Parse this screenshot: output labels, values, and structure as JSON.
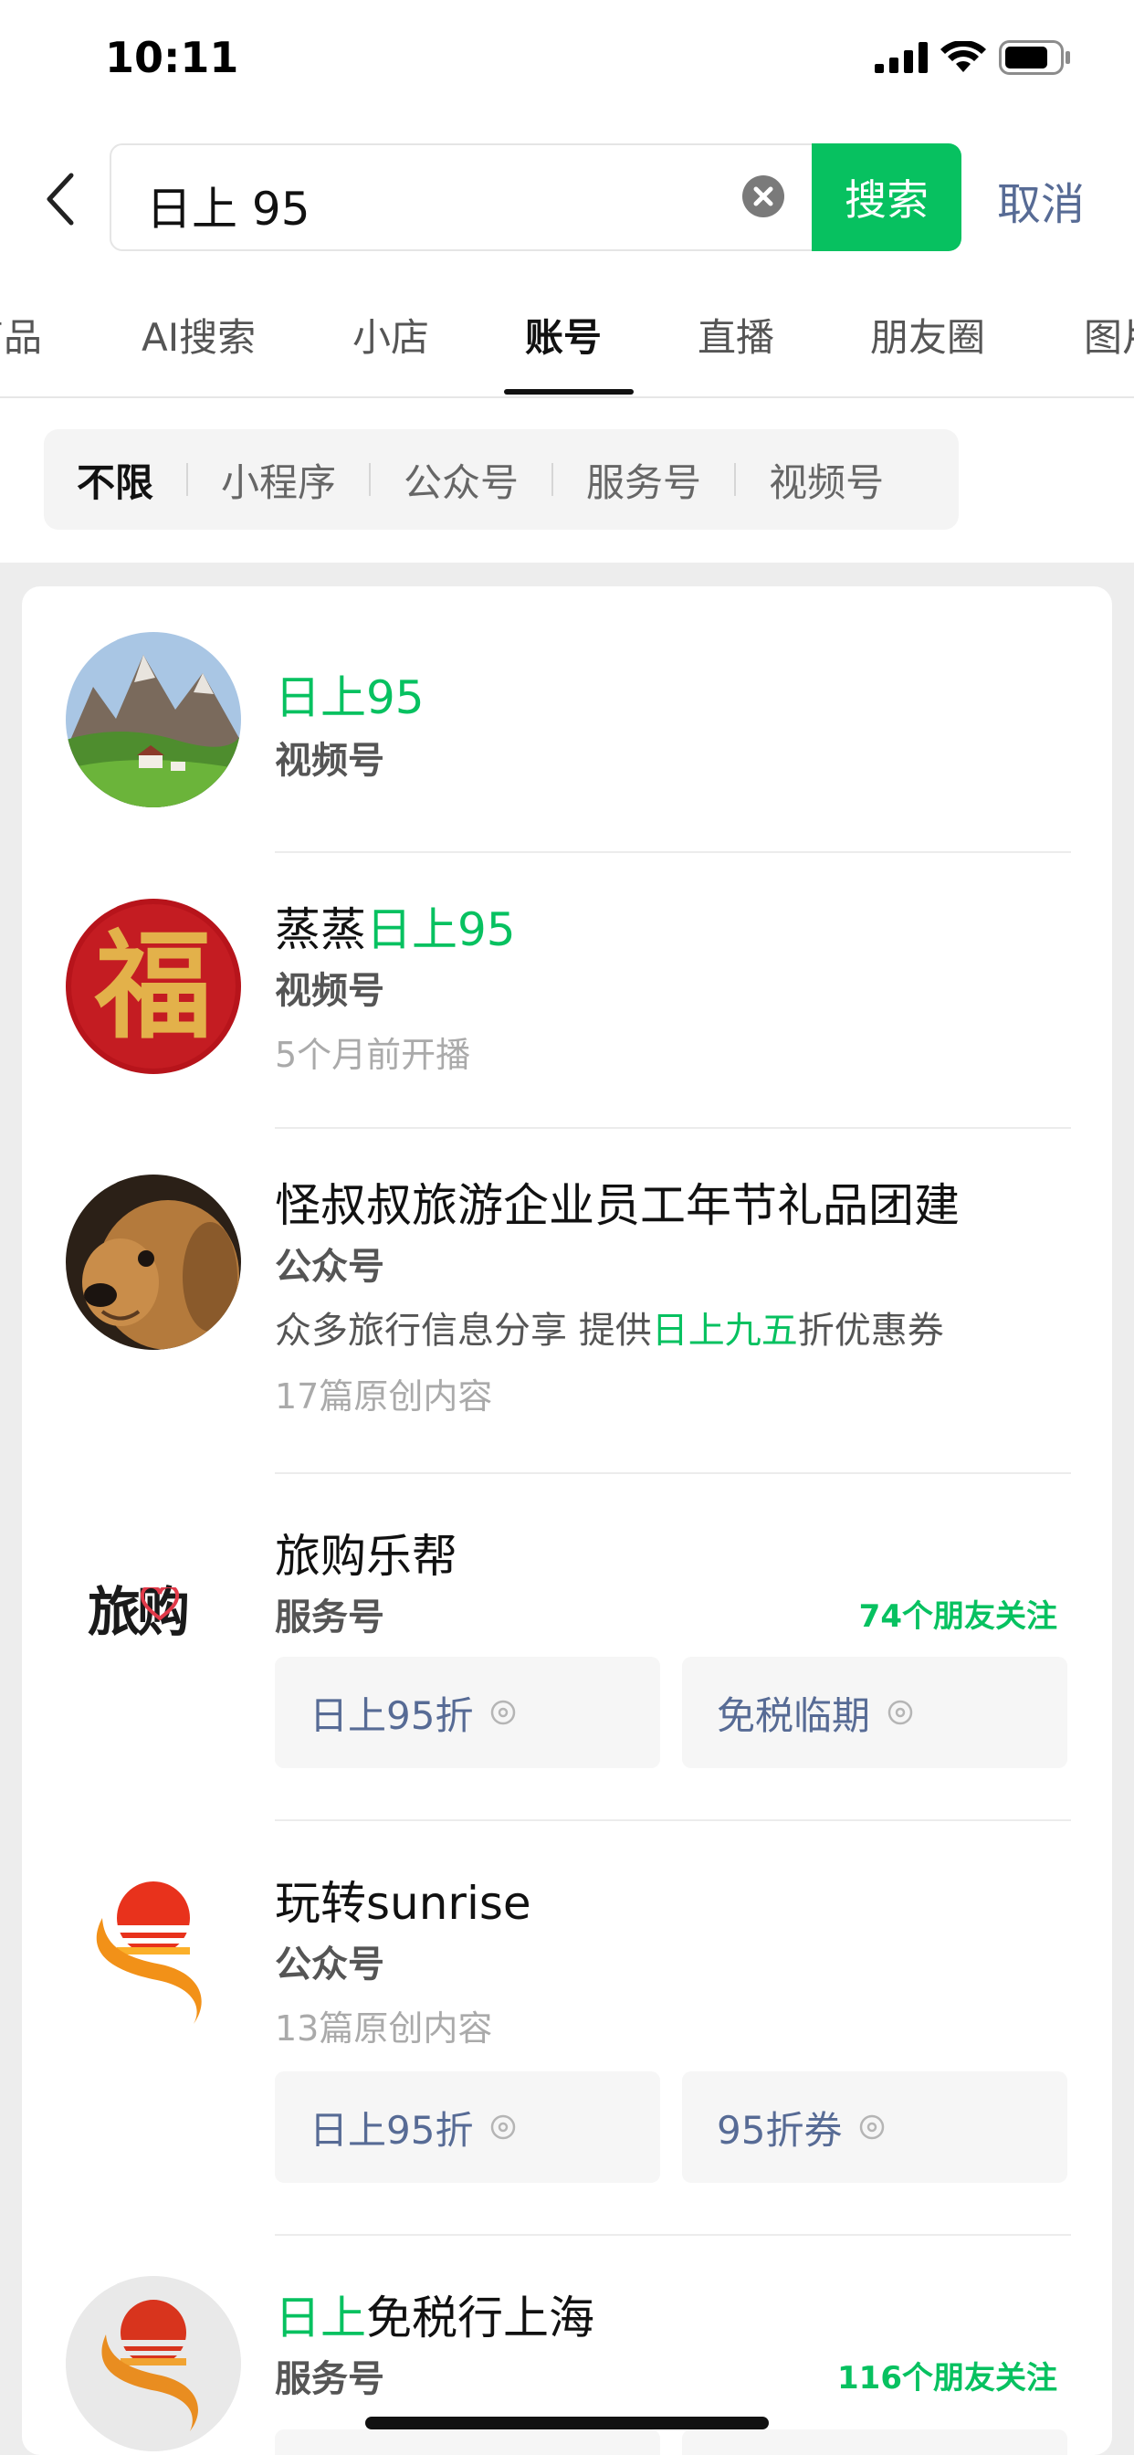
{
  "status_bar": {
    "time": "10:11"
  },
  "search": {
    "query": "日上 95",
    "search_label": "搜索",
    "cancel_label": "取消"
  },
  "tabs": [
    {
      "label": "商品"
    },
    {
      "label": "AI搜索"
    },
    {
      "label": "小店"
    },
    {
      "label": "账号",
      "active": true
    },
    {
      "label": "直播"
    },
    {
      "label": "朋友圈"
    },
    {
      "label": "图片"
    }
  ],
  "filters": [
    {
      "label": "不限",
      "active": true
    },
    {
      "label": "小程序"
    },
    {
      "label": "公众号"
    },
    {
      "label": "服务号"
    },
    {
      "label": "视频号"
    }
  ],
  "results": [
    {
      "title_hl": "日上95",
      "type": "视频号"
    },
    {
      "title_pre": "蒸蒸",
      "title_hl": "日上95",
      "type": "视频号",
      "meta": "5个月前开播"
    },
    {
      "title": "怪叔叔旅游企业员工年节礼品团建",
      "type": "公众号",
      "desc_pre": "众多旅行信息分享 提供",
      "desc_hl": "日上九五",
      "desc_post": "折优惠券",
      "meta": "17篇原创内容"
    },
    {
      "title": "旅购乐帮",
      "type": "服务号",
      "follow": "74个朋友关注",
      "logo_text": "旅购",
      "chips": [
        "日上95折",
        "免税临期"
      ]
    },
    {
      "title": "玩转sunrise",
      "type": "公众号",
      "meta": "13篇原创内容",
      "chips": [
        "日上95折",
        "95折券"
      ]
    },
    {
      "title_hl": "日上",
      "title_post": "免税行上海",
      "type": "服务号",
      "follow": "116个朋友关注"
    }
  ],
  "colors": {
    "accent_green": "#07c160",
    "link_blue": "#576b95"
  }
}
